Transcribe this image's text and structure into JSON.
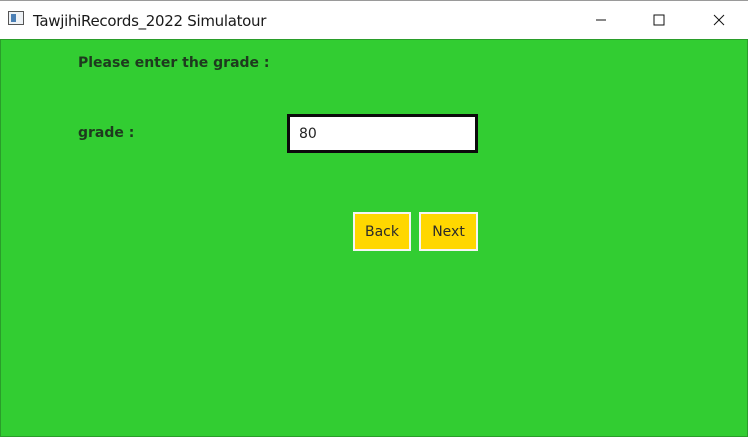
{
  "window": {
    "title": "TawjihiRecords_2022 Simulatour",
    "controls": {
      "minimize_icon": "minimize-icon",
      "maximize_icon": "maximize-icon",
      "close_icon": "close-icon"
    }
  },
  "form": {
    "prompt": "Please enter the grade :",
    "grade_label": "grade :",
    "grade_value": "80",
    "back_label": "Back",
    "next_label": "Next"
  },
  "colors": {
    "background": "#32cd32",
    "button": "#ffd700",
    "button_border": "#f5f5f5",
    "input_border": "#0b0b0b"
  }
}
